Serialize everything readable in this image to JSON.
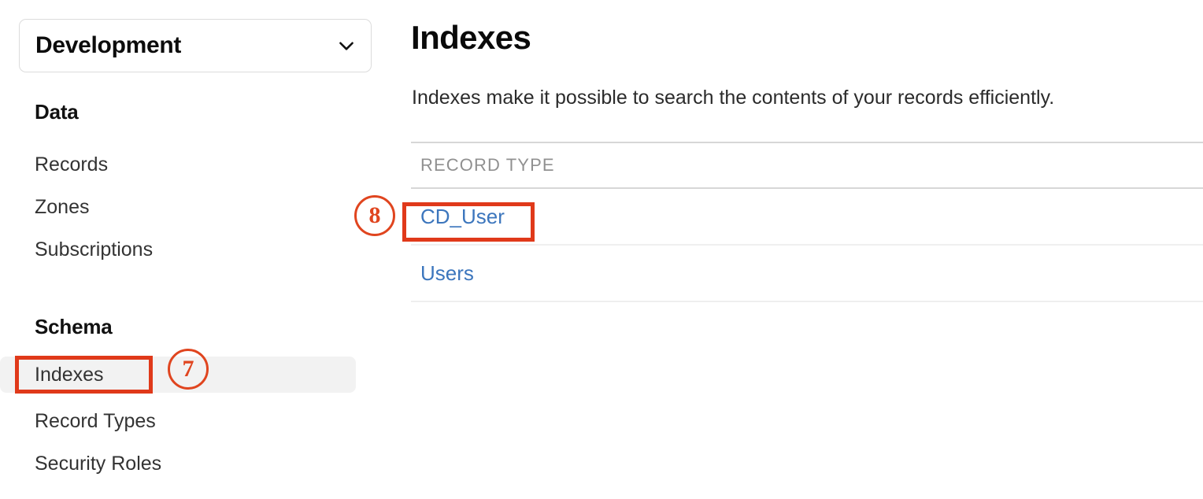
{
  "sidebar": {
    "environment_selector": {
      "value": "Development",
      "icon": "chevron-down-icon"
    },
    "sections": [
      {
        "heading": "Data",
        "items": [
          {
            "label": "Records",
            "selected": false
          },
          {
            "label": "Zones",
            "selected": false
          },
          {
            "label": "Subscriptions",
            "selected": false
          }
        ]
      },
      {
        "heading": "Schema",
        "items": [
          {
            "label": "Indexes",
            "selected": true
          },
          {
            "label": "Record Types",
            "selected": false
          },
          {
            "label": "Security Roles",
            "selected": false
          }
        ]
      }
    ]
  },
  "main": {
    "title": "Indexes",
    "subtitle": "Indexes make it possible to search the contents of your records efficiently.",
    "table": {
      "columns": [
        "RECORD TYPE"
      ],
      "rows": [
        {
          "record_type": "CD_User"
        },
        {
          "record_type": "Users"
        }
      ]
    }
  },
  "annotations": {
    "color": "#e0391a",
    "markers": [
      {
        "number": "⑦",
        "label": "7",
        "target": "sidebar-item-indexes"
      },
      {
        "number": "⑧",
        "label": "8",
        "target": "table-row-cd-user"
      }
    ]
  }
}
